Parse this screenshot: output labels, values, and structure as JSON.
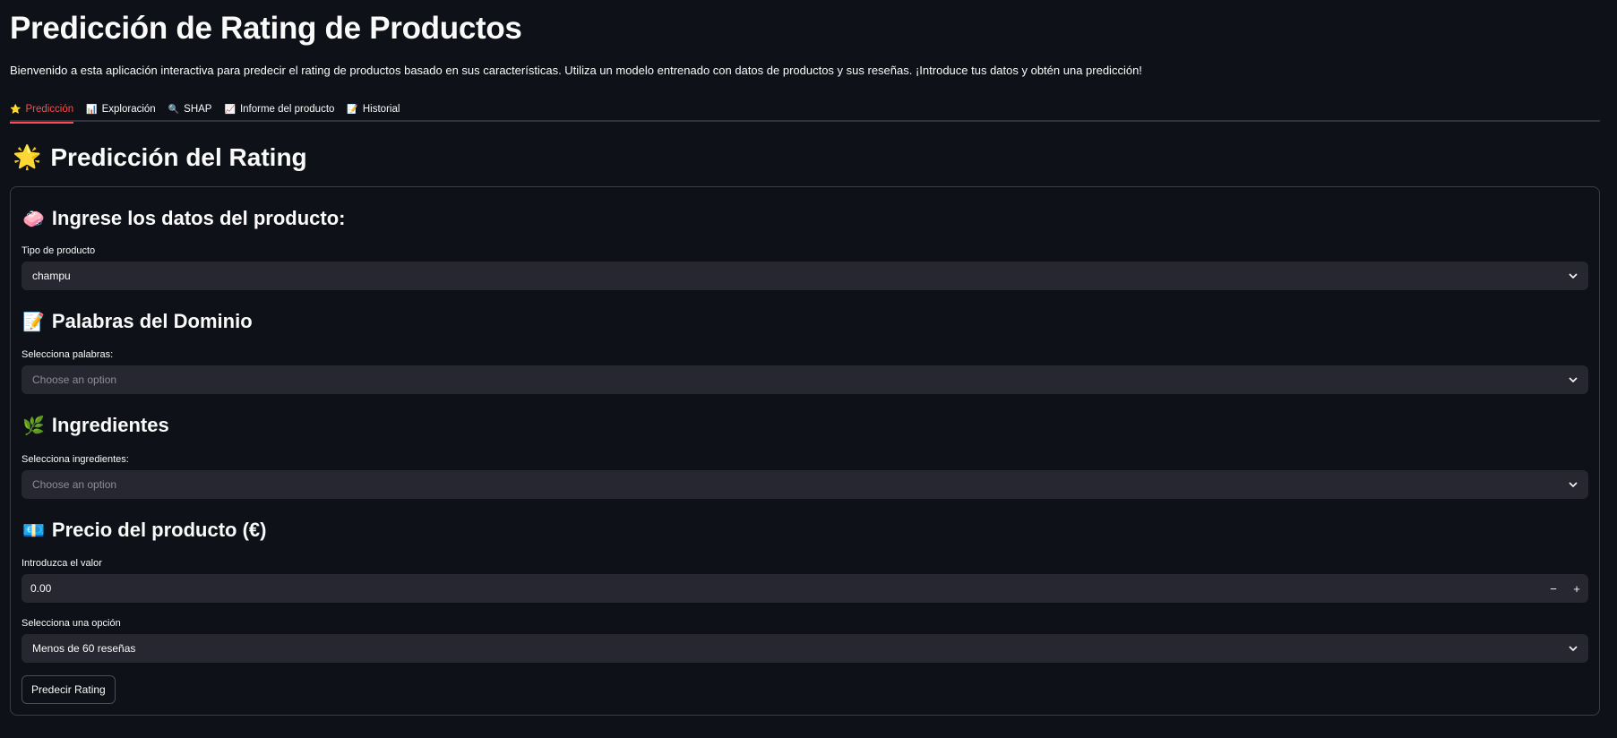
{
  "app": {
    "title": "Predicción de Rating de Productos",
    "description": "Bienvenido a esta aplicación interactiva para predecir el rating de productos basado en sus características. Utiliza un modelo entrenado con datos de productos y sus reseñas. ¡Introduce tus datos y obtén una predicción!"
  },
  "tabs": [
    {
      "icon": "⭐",
      "label": "Predicción",
      "active": true
    },
    {
      "icon": "📊",
      "label": "Exploración"
    },
    {
      "icon": "🔍",
      "label": "SHAP"
    },
    {
      "icon": "📈",
      "label": "Informe del producto"
    },
    {
      "icon": "📝",
      "label": "Historial"
    }
  ],
  "section": {
    "icon": "🌟",
    "title": "Predicción del Rating"
  },
  "form": {
    "product": {
      "icon": "🧼",
      "heading": "Ingrese los datos del producto:",
      "type_label": "Tipo de producto",
      "type_value": "champu"
    },
    "domain_words": {
      "icon": "📝",
      "heading": "Palabras del Dominio",
      "label": "Selecciona palabras:",
      "placeholder": "Choose an option"
    },
    "ingredients": {
      "icon": "🌿",
      "heading": "Ingredientes",
      "label": "Selecciona ingredientes:",
      "placeholder": "Choose an option"
    },
    "price": {
      "icon": "💶",
      "heading": "Precio del producto (€)",
      "label": "Introduzca el valor",
      "value": "0.00",
      "minus": "−",
      "plus": "+"
    },
    "reviews": {
      "label": "Selecciona una opción",
      "value": "Menos de 60 reseñas"
    },
    "submit_label": "Predecir Rating"
  },
  "colors": {
    "background": "#0e1117",
    "input_bg": "#262730",
    "accent": "#ff4b4b"
  }
}
